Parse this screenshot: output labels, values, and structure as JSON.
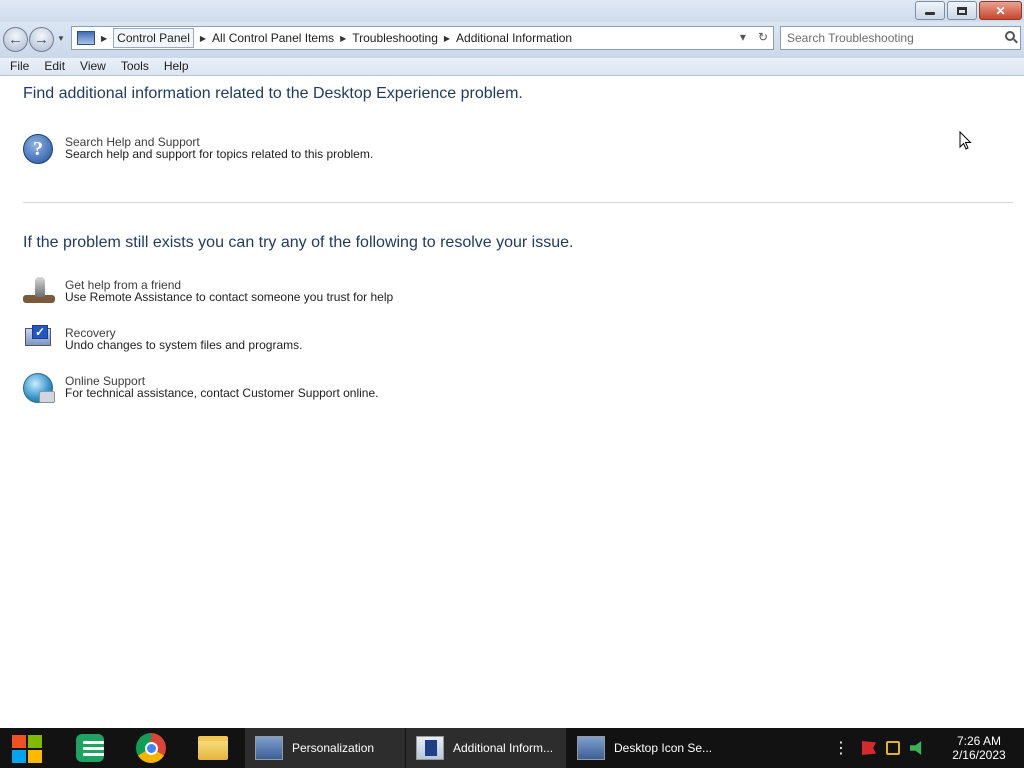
{
  "window": {
    "minimize_symbol": "",
    "maximize_symbol": "",
    "close_symbol": "✕"
  },
  "address_bar": {
    "crumbs": [
      "Control Panel",
      "All Control Panel Items",
      "Troubleshooting",
      "Additional Information"
    ],
    "dropdown_symbol": "▾",
    "refresh_symbol": "↻"
  },
  "search": {
    "placeholder": "Search Troubleshooting"
  },
  "menu": [
    "File",
    "Edit",
    "View",
    "Tools",
    "Help"
  ],
  "content": {
    "heading_top": "Find additional information related to the Desktop Experience problem.",
    "heading_bottom": "If the problem still exists you can try any of the following to resolve your issue.",
    "tasks": [
      {
        "title": "Search Help and Support",
        "description": "Search help and support for topics related to this problem.",
        "icon": "help-icon"
      },
      {
        "title": "Get help from a friend",
        "description": "Use Remote Assistance to contact someone you trust for help",
        "icon": "remote-assistance-icon"
      },
      {
        "title": "Recovery",
        "description": "Undo changes to system files and programs.",
        "icon": "recovery-icon"
      },
      {
        "title": "Online Support",
        "description": "For technical assistance, contact Customer Support online.",
        "icon": "globe-icon"
      }
    ]
  },
  "taskbar": {
    "pinned": [
      "start-icon",
      "sheets-icon",
      "chrome-icon",
      "folder-icon"
    ],
    "tasks": [
      {
        "label": "Personalization",
        "active": true
      },
      {
        "label": "Additional Inform...",
        "active": true
      },
      {
        "label": "Desktop Icon Se...",
        "active": false
      }
    ],
    "clock_time": "7:26 AM",
    "clock_date": "2/16/2023"
  },
  "colors": {
    "taskbar_bg": "#121212",
    "heading_text": "#1e3a5f",
    "title_bar": "#dfe9f5"
  }
}
